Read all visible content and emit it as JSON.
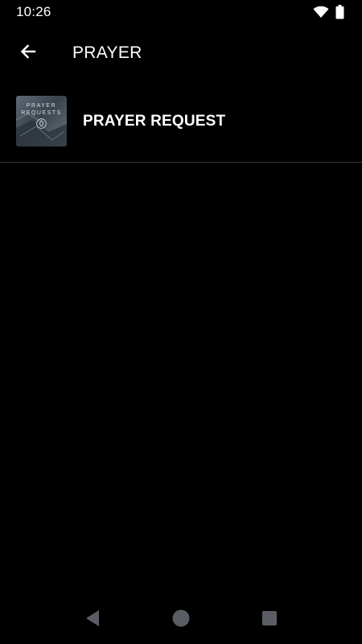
{
  "status_bar": {
    "time": "10:26",
    "icons": [
      "wifi-icon",
      "battery-icon"
    ]
  },
  "toolbar": {
    "back_icon": "arrow-left-icon",
    "title": "PRAYER"
  },
  "list": {
    "items": [
      {
        "label": "PRAYER REQUEST",
        "thumbnail_text": "PRAYER REQUESTS",
        "thumbnail_icon": "leaf-icon"
      }
    ]
  },
  "nav_bar": {
    "buttons": [
      "back-triangle-icon",
      "home-circle-icon",
      "recents-square-icon"
    ]
  },
  "colors": {
    "background": "#000000",
    "text": "#ffffff",
    "divider": "#3a3a3a",
    "nav_icons": "#5a5d63"
  }
}
